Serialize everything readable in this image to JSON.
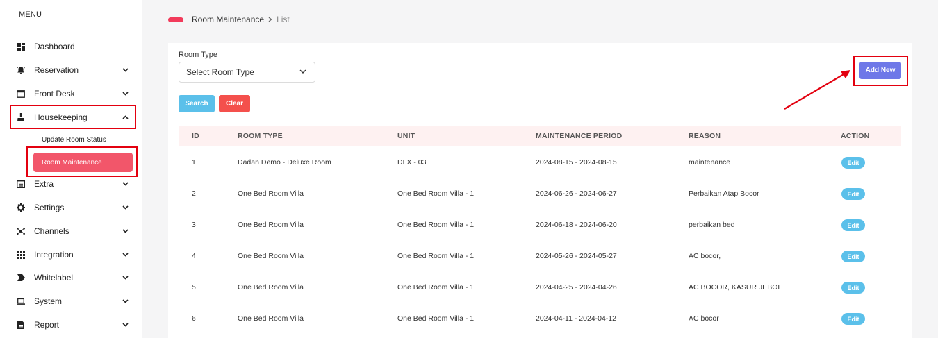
{
  "sidebar": {
    "menu_title": "MENU",
    "items": [
      {
        "label": "Dashboard",
        "icon": "dashboard-icon",
        "has_chevron": false
      },
      {
        "label": "Reservation",
        "icon": "bell-icon",
        "has_chevron": true
      },
      {
        "label": "Front Desk",
        "icon": "window-icon",
        "has_chevron": true
      },
      {
        "label": "Housekeeping",
        "icon": "broom-icon",
        "has_chevron": true,
        "expanded": true
      },
      {
        "label": "Extra",
        "icon": "list-icon",
        "has_chevron": true
      },
      {
        "label": "Settings",
        "icon": "gear-icon",
        "has_chevron": true
      },
      {
        "label": "Channels",
        "icon": "network-icon",
        "has_chevron": true
      },
      {
        "label": "Integration",
        "icon": "grid-icon",
        "has_chevron": true
      },
      {
        "label": "Whitelabel",
        "icon": "tag-icon",
        "has_chevron": true
      },
      {
        "label": "System",
        "icon": "laptop-icon",
        "has_chevron": true
      },
      {
        "label": "Report",
        "icon": "file-icon",
        "has_chevron": true
      }
    ],
    "submenu": {
      "update_room_status": "Update Room Status",
      "room_maintenance": "Room Maintenance"
    }
  },
  "breadcrumb": {
    "section": "Room Maintenance",
    "current": "List"
  },
  "filter": {
    "room_type_label": "Room Type",
    "room_type_value": "Select Room Type",
    "search_label": "Search",
    "clear_label": "Clear",
    "add_new_label": "Add New"
  },
  "table": {
    "columns": [
      "ID",
      "ROOM TYPE",
      "UNIT",
      "MAINTENANCE PERIOD",
      "REASON",
      "ACTION"
    ],
    "edit_label": "Edit",
    "rows": [
      {
        "id": "1",
        "room_type": "Dadan Demo - Deluxe Room",
        "unit": "DLX - 03",
        "period": "2024-08-15 - 2024-08-15",
        "reason": "maintenance"
      },
      {
        "id": "2",
        "room_type": "One Bed Room Villa",
        "unit": "One Bed Room Villa - 1",
        "period": "2024-06-26 - 2024-06-27",
        "reason": "Perbaikan Atap Bocor"
      },
      {
        "id": "3",
        "room_type": "One Bed Room Villa",
        "unit": "One Bed Room Villa - 1",
        "period": "2024-06-18 - 2024-06-20",
        "reason": "perbaikan bed"
      },
      {
        "id": "4",
        "room_type": "One Bed Room Villa",
        "unit": "One Bed Room Villa - 1",
        "period": "2024-05-26 - 2024-05-27",
        "reason": "AC bocor,"
      },
      {
        "id": "5",
        "room_type": "One Bed Room Villa",
        "unit": "One Bed Room Villa - 1",
        "period": "2024-04-25 - 2024-04-26",
        "reason": "AC BOCOR, KASUR JEBOL"
      },
      {
        "id": "6",
        "room_type": "One Bed Room Villa",
        "unit": "One Bed Room Villa - 1",
        "period": "2024-04-11 - 2024-04-12",
        "reason": "AC bocor"
      }
    ]
  },
  "colors": {
    "accent_pink": "#f2566a",
    "highlight_red": "#e3000f",
    "add_button": "#6e78e8",
    "info_blue": "#5bc0ea",
    "danger": "#f4504c"
  }
}
